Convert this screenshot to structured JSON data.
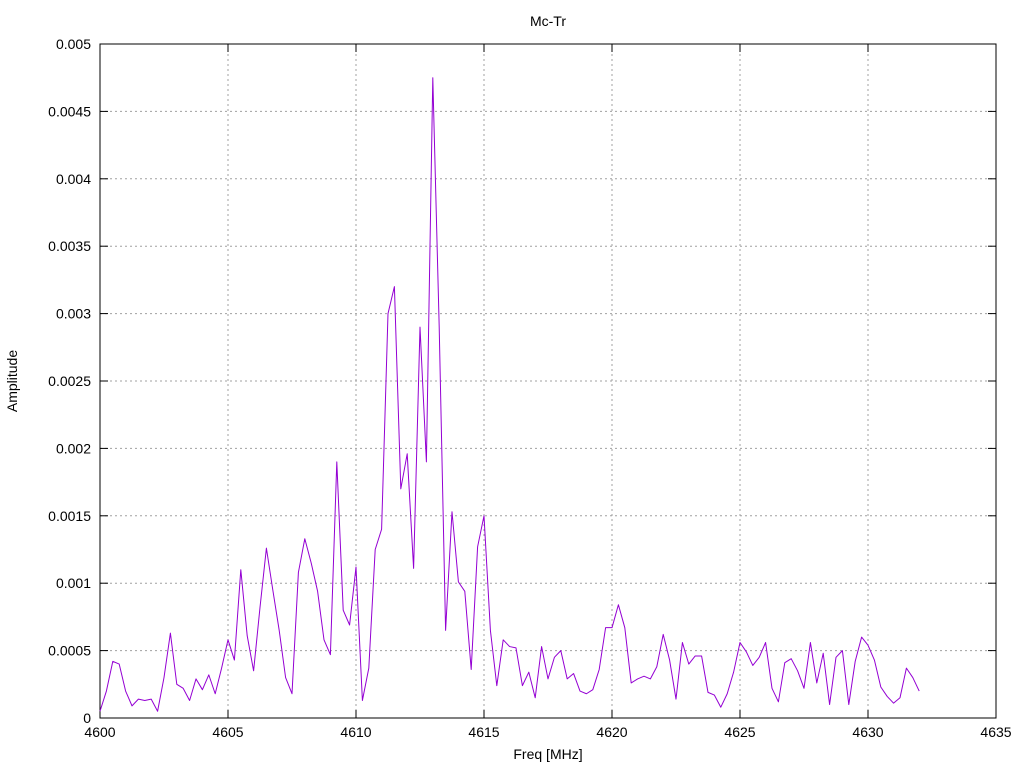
{
  "chart_data": {
    "type": "line",
    "title": "Mc-Tr",
    "xlabel": "Freq [MHz]",
    "ylabel": "Amplitude",
    "xlim": [
      4600,
      4635
    ],
    "ylim": [
      0,
      0.005
    ],
    "xticks": [
      4600,
      4605,
      4610,
      4615,
      4620,
      4625,
      4630,
      4635
    ],
    "yticks": [
      0,
      0.0005,
      0.001,
      0.0015,
      0.002,
      0.0025,
      0.003,
      0.0035,
      0.004,
      0.0045,
      0.005
    ],
    "x_tick_labels": [
      "4600",
      "4605",
      "4610",
      "4615",
      "4620",
      "4625",
      "4630",
      "4635"
    ],
    "y_tick_labels": [
      "0",
      "0.0005",
      "0.001",
      "0.0015",
      "0.002",
      "0.0025",
      "0.003",
      "0.0035",
      "0.004",
      "0.0045",
      "0.005"
    ],
    "grid": true,
    "series": [
      {
        "color": "#9400d3",
        "x": [
          4600.0,
          4600.25,
          4600.5,
          4600.75,
          4601.0,
          4601.25,
          4601.5,
          4601.75,
          4602.0,
          4602.25,
          4602.5,
          4602.75,
          4603.0,
          4603.25,
          4603.5,
          4603.75,
          4604.0,
          4604.25,
          4604.5,
          4604.75,
          4605.0,
          4605.25,
          4605.5,
          4605.75,
          4606.0,
          4606.25,
          4606.5,
          4606.75,
          4607.0,
          4607.25,
          4607.5,
          4607.75,
          4608.0,
          4608.25,
          4608.5,
          4608.75,
          4609.0,
          4609.25,
          4609.5,
          4609.75,
          4610.0,
          4610.25,
          4610.5,
          4610.75,
          4611.0,
          4611.25,
          4611.5,
          4611.75,
          4612.0,
          4612.25,
          4612.5,
          4612.75,
          4613.0,
          4613.25,
          4613.5,
          4613.75,
          4614.0,
          4614.25,
          4614.5,
          4614.75,
          4615.0,
          4615.25,
          4615.5,
          4615.75,
          4616.0,
          4616.25,
          4616.5,
          4616.75,
          4617.0,
          4617.25,
          4617.5,
          4617.75,
          4618.0,
          4618.25,
          4618.5,
          4618.75,
          4619.0,
          4619.25,
          4619.5,
          4619.75,
          4620.0,
          4620.25,
          4620.5,
          4620.75,
          4621.0,
          4621.25,
          4621.5,
          4621.75,
          4622.0,
          4622.25,
          4622.5,
          4622.75,
          4623.0,
          4623.25,
          4623.5,
          4623.75,
          4624.0,
          4624.25,
          4624.5,
          4624.75,
          4625.0,
          4625.25,
          4625.5,
          4625.75,
          4626.0,
          4626.25,
          4626.5,
          4626.75,
          4627.0,
          4627.25,
          4627.5,
          4627.75,
          4628.0,
          4628.25,
          4628.5,
          4628.75,
          4629.0,
          4629.25,
          4629.5,
          4629.75,
          4630.0,
          4630.25,
          4630.5,
          4630.75,
          4631.0,
          4631.25,
          4631.5,
          4631.75,
          4632.0
        ],
        "y": [
          5e-05,
          0.0002,
          0.00042,
          0.0004,
          0.0002,
          9e-05,
          0.00014,
          0.00013,
          0.00014,
          5e-05,
          0.0003,
          0.00063,
          0.00025,
          0.00022,
          0.00013,
          0.00029,
          0.00021,
          0.00032,
          0.00018,
          0.00037,
          0.00058,
          0.00043,
          0.0011,
          0.00061,
          0.00035,
          0.00082,
          0.00126,
          0.00095,
          0.00065,
          0.0003,
          0.00018,
          0.00108,
          0.00133,
          0.00115,
          0.00094,
          0.00058,
          0.00047,
          0.0019,
          0.0008,
          0.00069,
          0.00112,
          0.00013,
          0.00037,
          0.00125,
          0.0014,
          0.003,
          0.0032,
          0.0017,
          0.00196,
          0.00111,
          0.0029,
          0.0019,
          0.00475,
          0.0029,
          0.00065,
          0.00153,
          0.00101,
          0.00094,
          0.00036,
          0.00127,
          0.0015,
          0.00065,
          0.00024,
          0.00058,
          0.00053,
          0.00052,
          0.00024,
          0.00034,
          0.00015,
          0.00053,
          0.00029,
          0.00045,
          0.0005,
          0.00029,
          0.00033,
          0.0002,
          0.00018,
          0.00021,
          0.00036,
          0.00067,
          0.00067,
          0.00084,
          0.00067,
          0.00026,
          0.00029,
          0.00031,
          0.00029,
          0.00038,
          0.00062,
          0.00043,
          0.00014,
          0.00056,
          0.0004,
          0.00046,
          0.00046,
          0.00019,
          0.00017,
          8e-05,
          0.00018,
          0.00034,
          0.00056,
          0.00049,
          0.00039,
          0.00045,
          0.00056,
          0.00022,
          0.00012,
          0.00041,
          0.00044,
          0.00035,
          0.00022,
          0.00056,
          0.00026,
          0.00048,
          0.0001,
          0.00045,
          0.0005,
          0.0001,
          0.00042,
          0.0006,
          0.00054,
          0.00043,
          0.00023,
          0.00016,
          0.00011,
          0.00015,
          0.00037,
          0.0003,
          0.0002
        ]
      }
    ]
  }
}
